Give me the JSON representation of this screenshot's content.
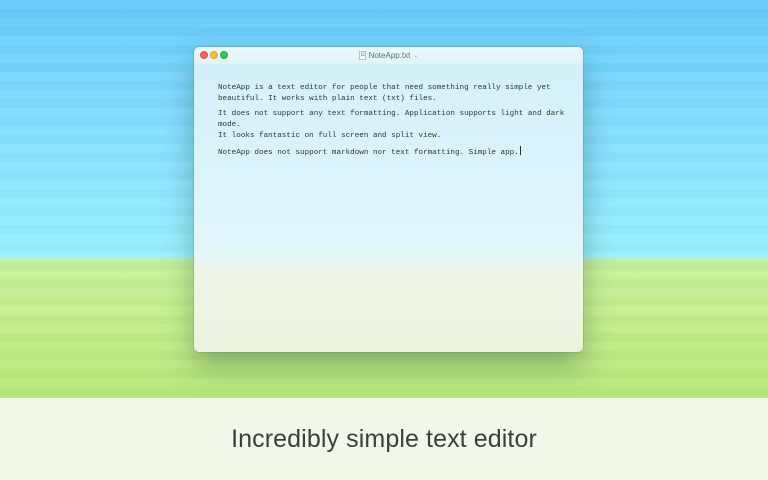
{
  "window": {
    "title": "NoteApp.txt",
    "title_chevron": "⌄"
  },
  "editor": {
    "paragraphs": [
      "NoteApp is a text editor for people that need something really simple yet\nbeautiful. It works with plain text (txt) files.",
      "It does not support any text formatting. Application supports light and dark mode.\nIt looks fantastic on full screen and split view.",
      "NoteApp does not support markdown nor text formatting. Simple app."
    ]
  },
  "caption": {
    "text": "Incredibly simple text editor"
  },
  "colors": {
    "traffic_close": "#fc605c",
    "traffic_minimize": "#fdbc40",
    "traffic_zoom": "#34c84a",
    "sky": "#7fdcff",
    "grass": "#c6ef8c"
  }
}
